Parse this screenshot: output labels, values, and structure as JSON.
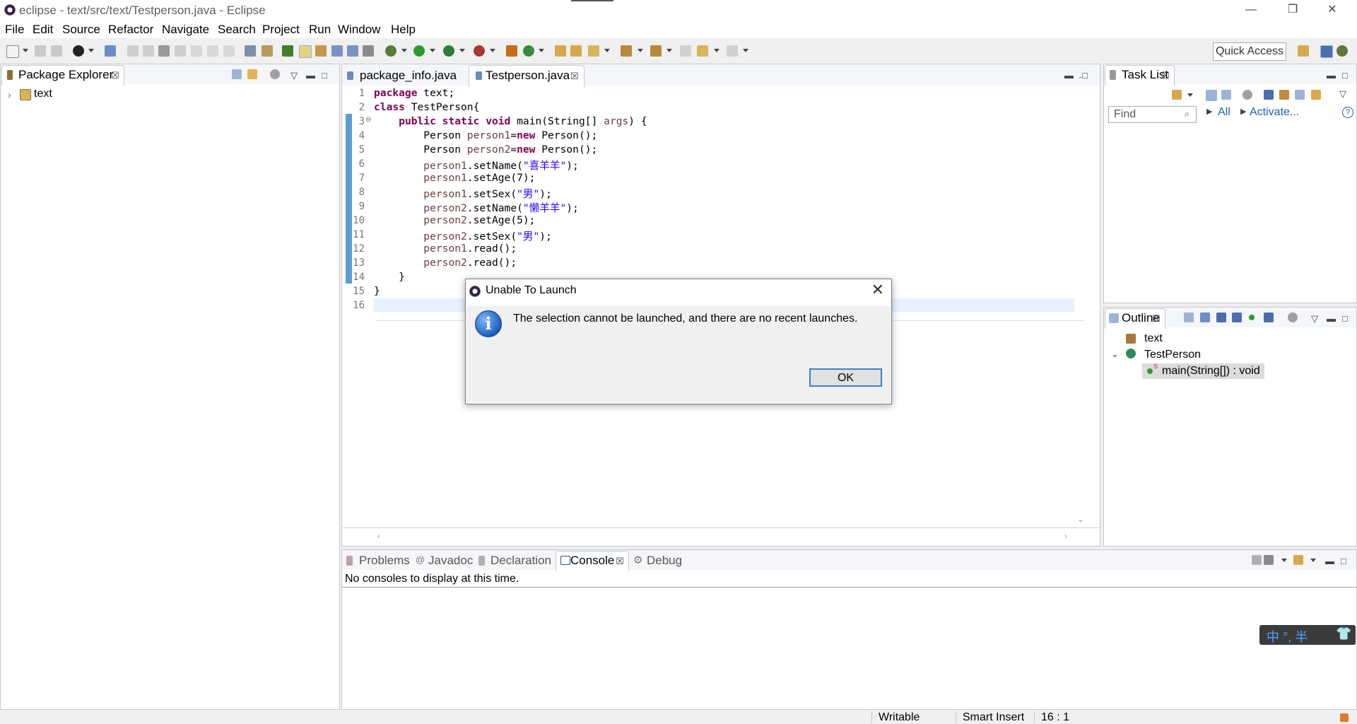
{
  "window": {
    "title": "eclipse - text/src/text/Testperson.java - Eclipse",
    "minimize_glyph": "—",
    "restore_glyph": "❐",
    "close_glyph": "✕"
  },
  "menu": [
    "File",
    "Edit",
    "Source",
    "Refactor",
    "Navigate",
    "Search",
    "Project",
    "Run",
    "Window",
    "Help"
  ],
  "toolbar": {
    "quick_access": "Quick Access"
  },
  "package_explorer": {
    "title": "Package Explorer",
    "items": [
      {
        "label": "text",
        "expander": "›"
      }
    ]
  },
  "editor": {
    "tabs": [
      {
        "label": "package_info.java",
        "active": false
      },
      {
        "label": "Testperson.java",
        "active": true
      }
    ],
    "line_numbers": [
      "1",
      "2",
      "3",
      "4",
      "5",
      "6",
      "7",
      "8",
      "9",
      "10",
      "11",
      "12",
      "13",
      "14",
      "15",
      "16"
    ],
    "fold_marker": "⊖",
    "code": [
      "package text;",
      "class TestPerson{",
      "    public static void main(String[] args) {",
      "        Person person1=new Person();",
      "        Person person2=new Person();",
      "        person1.setName(\"喜羊羊\");",
      "        person1.setAge(7);",
      "        person1.setSex(\"男\");",
      "        person2.setName(\"懒羊羊\");",
      "        person2.setAge(5);",
      "        person2.setSex(\"男\");",
      "        person1.read();",
      "        person2.read();",
      "    }",
      "}",
      ""
    ]
  },
  "task_list": {
    "title": "Task List",
    "find_placeholder": "Find",
    "all_link": "All",
    "activate_link": "Activate..."
  },
  "outline": {
    "title": "Outline",
    "items": [
      {
        "label": "text"
      },
      {
        "label": "TestPerson"
      },
      {
        "label": "main(String[]) : void"
      }
    ]
  },
  "bottom_panel": {
    "tabs": [
      "Problems",
      "Javadoc",
      "Declaration",
      "Console",
      "Debug"
    ],
    "active_tab": "Console",
    "console_message": "No consoles to display at this time."
  },
  "dialog": {
    "title": "Unable To Launch",
    "message": "The selection cannot be launched, and there are no recent launches.",
    "info_glyph": "i",
    "ok_label": "OK",
    "close_glyph": "✕"
  },
  "status_bar": {
    "writable": "Writable",
    "insert_mode": "Smart Insert",
    "position": "16 : 1"
  },
  "ime": {
    "text": "中 °, 半"
  },
  "colors": {
    "keyword": "#7f0055",
    "local_var": "#6a3e3e",
    "string": "#2a00ff",
    "accent": "#3c7fd0"
  }
}
